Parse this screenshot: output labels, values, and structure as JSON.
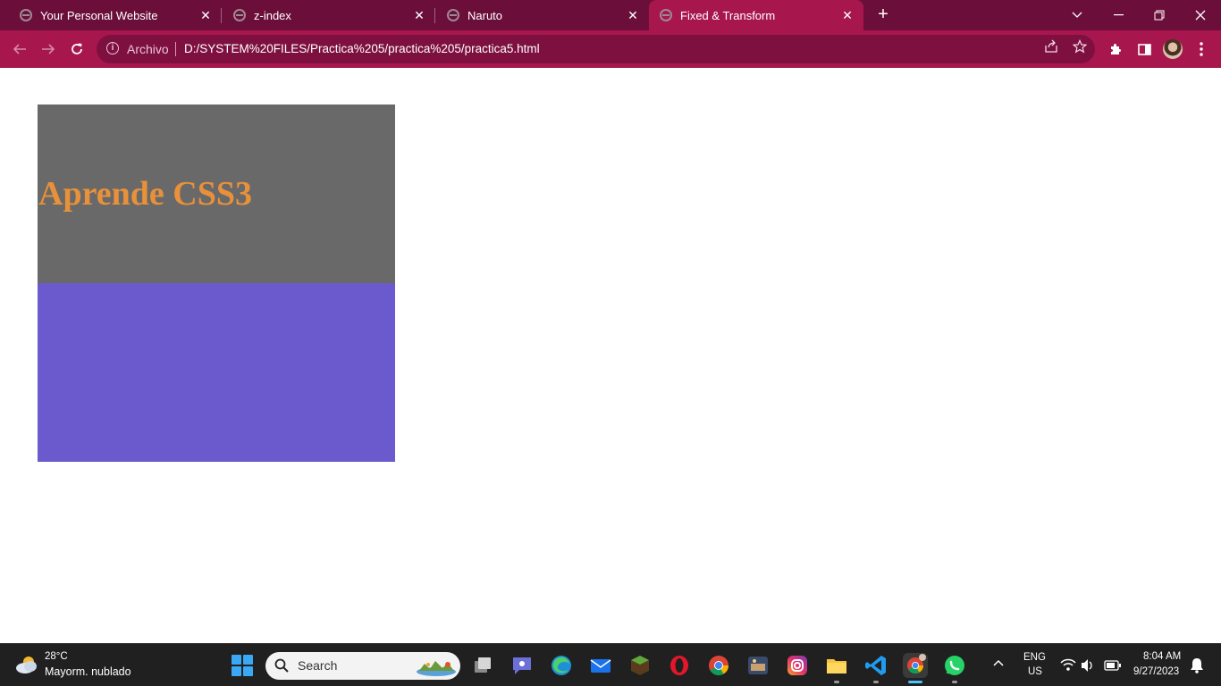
{
  "browser": {
    "tabs": [
      {
        "title": "Your Personal Website",
        "close": "✕"
      },
      {
        "title": "z-index",
        "close": "✕"
      },
      {
        "title": "Naruto",
        "close": "✕"
      },
      {
        "title": "Fixed & Transform",
        "close": "✕",
        "active": true
      }
    ],
    "new_tab": "+",
    "address_label": "Archivo",
    "url": "D:/SYSTEM%20FILES/Practica%205/practica%205/practica5.html"
  },
  "page": {
    "heading": "Aprende CSS3",
    "colors": {
      "gray_box": "#696969",
      "purple_box": "#6a5acd",
      "heading": "#e8913a"
    }
  },
  "taskbar": {
    "weather_temp": "28°C",
    "weather_desc": "Mayorm. nublado",
    "search_label": "Search",
    "lang_line1": "ENG",
    "lang_line2": "US",
    "time": "8:04 AM",
    "date": "9/27/2023"
  },
  "theme": {
    "tabbar": "#6b0f3a",
    "toolbar": "#a8164e"
  }
}
